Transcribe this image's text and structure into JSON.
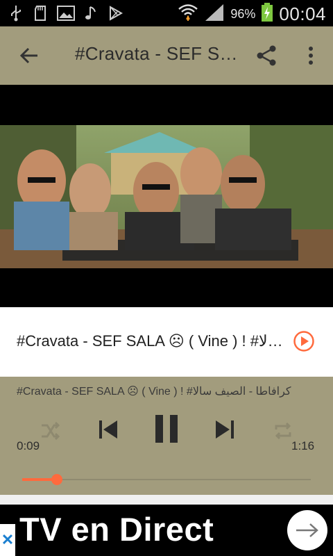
{
  "status_bar": {
    "icons_left": [
      "usb-icon",
      "sd-card-icon",
      "image-icon",
      "music-icon",
      "play-store-icon"
    ],
    "icons_right": [
      "wifi-icon",
      "signal-icon",
      "battery-icon"
    ],
    "battery_percent": "96%",
    "time": "00:04"
  },
  "toolbar": {
    "title": "#Cravata - SEF SALA ☹ ( Vine ) ! #كرافاطا - الصيف سالا",
    "back_icon": "arrow-back-icon",
    "share_icon": "share-icon",
    "more_icon": "more-vert-icon"
  },
  "now_playing": {
    "title": "#Cravata - SEF SALA ☹ ( Vine ) ! #كرافاطا - الصيف سالا"
  },
  "player": {
    "track_title": "#Cravata - SEF SALA ☹  ( Vine ) ! #كرافاطا - الصيف سالا",
    "elapsed": "0:09",
    "duration": "1:16",
    "progress_fraction": 0.12,
    "accent_color": "#ff6a3d",
    "controls": [
      "shuffle-icon",
      "skip-previous-icon",
      "pause-icon",
      "skip-next-icon",
      "repeat-icon"
    ]
  },
  "ad": {
    "text": "TV en Direct",
    "close_icon": "close-icon",
    "arrow_icon": "arrow-right-icon"
  }
}
